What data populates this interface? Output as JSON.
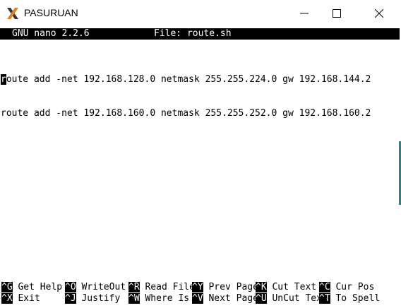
{
  "window": {
    "title": "PASURUAN",
    "minimize_label": "minimize",
    "maximize_label": "maximize",
    "close_label": "close"
  },
  "nano": {
    "version": "GNU nano 2.2.6",
    "file_label": "File: route.sh",
    "cursor_char": "r",
    "lines": [
      "oute add -net 192.168.128.0 netmask 255.255.224.0 gw 192.168.144.2",
      "route add -net 192.168.160.0 netmask 255.255.252.0 gw 192.168.160.2"
    ],
    "shortcuts_row1": [
      {
        "key": "^G",
        "label": " Get Help"
      },
      {
        "key": "^O",
        "label": " WriteOut"
      },
      {
        "key": "^R",
        "label": " Read File"
      },
      {
        "key": "^Y",
        "label": " Prev Page"
      },
      {
        "key": "^K",
        "label": " Cut Text"
      },
      {
        "key": "^C",
        "label": " Cur Pos"
      }
    ],
    "shortcuts_row2": [
      {
        "key": "^X",
        "label": " Exit"
      },
      {
        "key": "^J",
        "label": " Justify"
      },
      {
        "key": "^W",
        "label": " Where Is"
      },
      {
        "key": "^V",
        "label": " Next Page"
      },
      {
        "key": "^U",
        "label": " UnCut Tex"
      },
      {
        "key": "^T",
        "label": " To Spell"
      }
    ]
  },
  "colors": {
    "terminal_bg": "#ffffff",
    "text": "#000000",
    "header_bg": "#000000"
  }
}
